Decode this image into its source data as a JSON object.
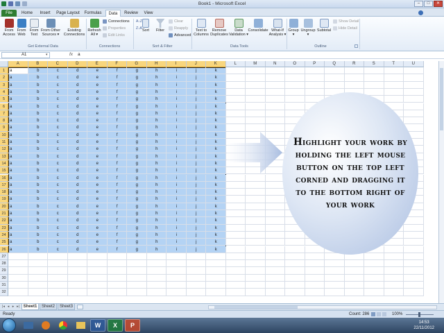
{
  "window": {
    "title": "Book1 - Microsoft Excel",
    "controls": [
      "–",
      "□",
      "✕"
    ]
  },
  "tabs": [
    {
      "label": "File",
      "state": "file"
    },
    {
      "label": "Home",
      "state": ""
    },
    {
      "label": "Insert",
      "state": ""
    },
    {
      "label": "Page Layout",
      "state": ""
    },
    {
      "label": "Formulas",
      "state": ""
    },
    {
      "label": "Data",
      "state": "active"
    },
    {
      "label": "Review",
      "state": ""
    },
    {
      "label": "View",
      "state": ""
    }
  ],
  "ribbon": {
    "get_external_data": {
      "label": "Get External Data",
      "buttons": [
        "From\nAccess",
        "From\nWeb",
        "From\nText",
        "From Other\nSources ▾"
      ],
      "existing": "Existing\nConnections"
    },
    "connections": {
      "label": "Connections",
      "refresh": "Refresh\nAll ▾",
      "items": [
        "Connections",
        "Properties",
        "Edit Links"
      ]
    },
    "sort_filter": {
      "label": "Sort & Filter",
      "sort": "Sort",
      "filter": "Filter",
      "items": [
        "Clear",
        "Reapply",
        "Advanced"
      ]
    },
    "data_tools": {
      "label": "Data Tools",
      "buttons": [
        "Text to\nColumns",
        "Remove\nDuplicates",
        "Data\nValidation ▾",
        "Consolidate",
        "What-If\nAnalysis ▾"
      ]
    },
    "outline": {
      "label": "Outline",
      "buttons": [
        "Group\n▾",
        "Ungroup\n▾",
        "Subtotal"
      ],
      "items": [
        "Show Detail",
        "Hide Detail"
      ]
    }
  },
  "formula_bar": {
    "name_box": "A1",
    "fx": "fx",
    "value": "a"
  },
  "grid": {
    "columns": [
      "A",
      "B",
      "C",
      "D",
      "E",
      "F",
      "G",
      "H",
      "I",
      "J",
      "K",
      "L",
      "M",
      "N",
      "O",
      "P",
      "Q",
      "R",
      "S",
      "T",
      "U"
    ],
    "row_labels": [
      "1",
      "2",
      "3",
      "4",
      "5",
      "6",
      "7",
      "8",
      "9",
      "10",
      "11",
      "12",
      "13",
      "14",
      "15",
      "16",
      "17",
      "18",
      "19",
      "20",
      "21",
      "22",
      "23",
      "24",
      "25",
      "26",
      "27",
      "28",
      "29",
      "30",
      "31",
      "32"
    ],
    "row_values": [
      "a",
      "b",
      "c",
      "d",
      "e",
      "f",
      "g",
      "h",
      "i",
      "j",
      "k"
    ],
    "selected_columns": 11,
    "selected_rows": 26
  },
  "annotation": {
    "text": "Highlight your work by holding the left mouse button  on the top left corned  and dragging it to the bottom right of your work"
  },
  "sheets": [
    {
      "label": "Sheet1",
      "active": true
    },
    {
      "label": "Sheet2",
      "active": false
    },
    {
      "label": "Sheet3",
      "active": false
    }
  ],
  "status": {
    "ready": "Ready",
    "count": "Count: 286",
    "zoom": "100%"
  },
  "taskbar": {
    "apps": [
      "word-icon",
      "excel-icon",
      "powerpoint-icon"
    ],
    "time": "14:53",
    "date": "22/11/2012"
  },
  "colors": {
    "selection": "#9bc4f0",
    "header_selected": "#f8d67e",
    "file_tab": "#2f7d32",
    "bubble": "#a9bde0"
  }
}
